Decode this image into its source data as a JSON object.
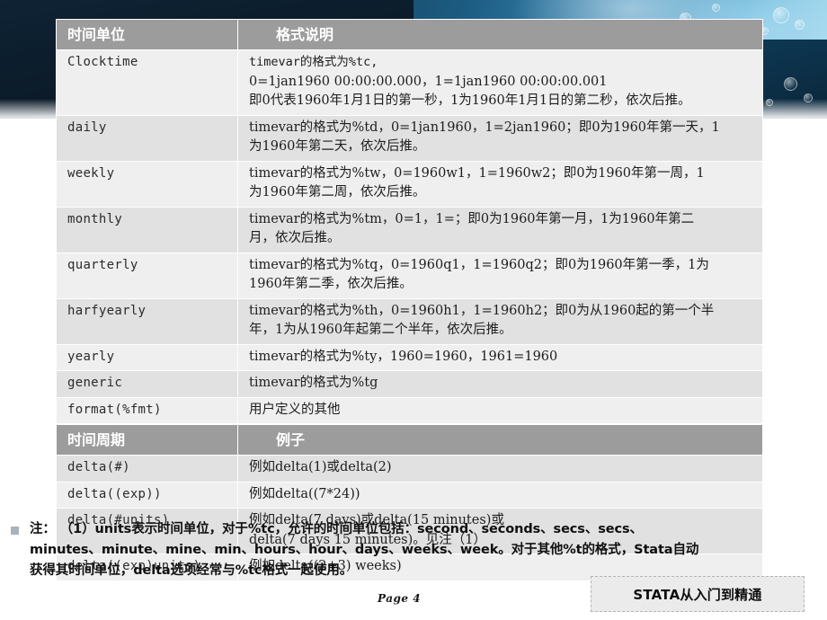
{
  "slide": {
    "page_label": "Page  4",
    "brand_badge": "STATA从入门到精通"
  },
  "table_one": {
    "headers": [
      "时间单位",
      "格式说明"
    ],
    "rows": [
      {
        "unit": "Clocktime",
        "lines": [
          "timevar的格式为%tc,",
          "0=1jan1960 00:00:00.000，1=1jan1960 00:00:00.001",
          "即0代表1960年1月1日的第一秒，1为1960年1月1日的第二秒，依次后推。"
        ]
      },
      {
        "unit": "daily",
        "lines": [
          "timevar的格式为%td，0=1jan1960，1=2jan1960；即0为1960年第一天，1",
          "为1960年第二天，依次后推。"
        ]
      },
      {
        "unit": "weekly",
        "lines": [
          "timevar的格式为%tw，0=1960w1，1=1960w2；即0为1960年第一周，1",
          "为1960年第二周，依次后推。"
        ]
      },
      {
        "unit": "monthly",
        "lines": [
          "timevar的格式为%tm，0=1，1=；即0为1960年第一月，1为1960年第二",
          "月，依次后推。"
        ]
      },
      {
        "unit": "quarterly",
        "lines": [
          "timevar的格式为%tq，0=1960q1，1=1960q2；即0为1960年第一季，1为",
          "1960年第二季，依次后推。"
        ]
      },
      {
        "unit": "harfyearly",
        "lines": [
          "timevar的格式为%th，0=1960h1，1=1960h2；即0为从1960起的第一个半",
          "年，1为从1960年起第二个半年，依次后推。"
        ]
      },
      {
        "unit": "yearly",
        "lines": [
          "timevar的格式为%ty，1960=1960，1961=1960"
        ]
      },
      {
        "unit": "generic",
        "lines": [
          "timevar的格式为%tg"
        ]
      },
      {
        "unit": "format(%fmt)",
        "lines": [
          "用户定义的其他"
        ]
      }
    ]
  },
  "table_two": {
    "headers": [
      "时间周期",
      "例子"
    ],
    "rows": [
      {
        "unit": "delta(#)",
        "lines": [
          "例如delta(1)或delta(2)"
        ]
      },
      {
        "unit": "delta((exp))",
        "lines": [
          "例如delta((7*24))"
        ]
      },
      {
        "unit": "delta(#units)",
        "lines": [
          "例如delta(7 days)或delta(15 minutes)或",
          "delta(7 days 15 minutes)。见注（1）"
        ]
      },
      {
        "unit": "delta((exp)units)",
        "lines": [
          "例如delta((2+3) weeks)"
        ]
      }
    ]
  },
  "note": {
    "lines": [
      "注： （1）units表示时间单位，对于%tc，允许的时间单位包括：second、seconds、secs、secs、",
      "minutes、minute、mine、min、hours、hour、days、weeks、week。对于其他%t的格式，Stata自动",
      "获得其时间单位，delta选项经常与%tc格式一起使用。"
    ]
  },
  "colors": {
    "header_gray": "#9c9c9c",
    "row_light": "#efefef",
    "row_dark": "#e1e1e1",
    "banner_dark": "#0c1c2c",
    "banner_light": "#a9dcef"
  }
}
